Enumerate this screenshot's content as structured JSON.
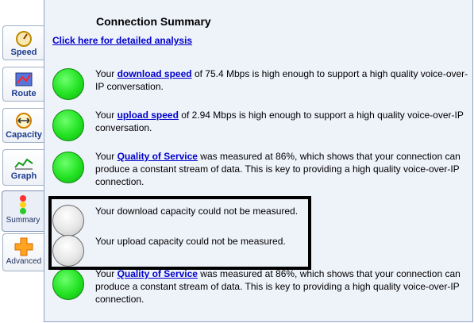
{
  "tabs": [
    {
      "label": "Speed",
      "icon": "speedometer-icon"
    },
    {
      "label": "Route",
      "icon": "route-icon"
    },
    {
      "label": "Capacity",
      "icon": "capacity-icon"
    },
    {
      "label": "Graph",
      "icon": "graph-icon"
    },
    {
      "label": "Summary",
      "icon": "traffic-light-icon"
    },
    {
      "label": "Advanced",
      "icon": "plus-icon"
    }
  ],
  "title": "Connection Summary",
  "detailed_link": "Click here for detailed analysis",
  "rows": [
    {
      "status": "green",
      "pre": "Your ",
      "link": "download speed",
      "post": " of 75.4 Mbps is high enough to support a high quality voice-over-IP conversation."
    },
    {
      "status": "green",
      "pre": "Your ",
      "link": "upload speed",
      "post": " of 2.94 Mbps is high enough to support a high quality voice-over-IP conversation."
    },
    {
      "status": "green",
      "pre": "Your ",
      "link": "Quality of Service",
      "post": " was measured at 86%, which shows that your connection can produce a constant stream of data. This is key to providing a high quality voice-over-IP connection."
    },
    {
      "status": "grey",
      "text": "Your download capacity could not be measured."
    },
    {
      "status": "grey",
      "text": "Your upload capacity could not be measured."
    },
    {
      "status": "green",
      "pre": "Your ",
      "link": "Quality of Service",
      "post": " was measured at 86%, which shows that your connection can produce a constant stream of data. This is key to providing a high quality voice-over-IP connection."
    }
  ],
  "colors": {
    "link": "#0000cc",
    "ok": "#22e222",
    "panel": "#eef2f9"
  }
}
